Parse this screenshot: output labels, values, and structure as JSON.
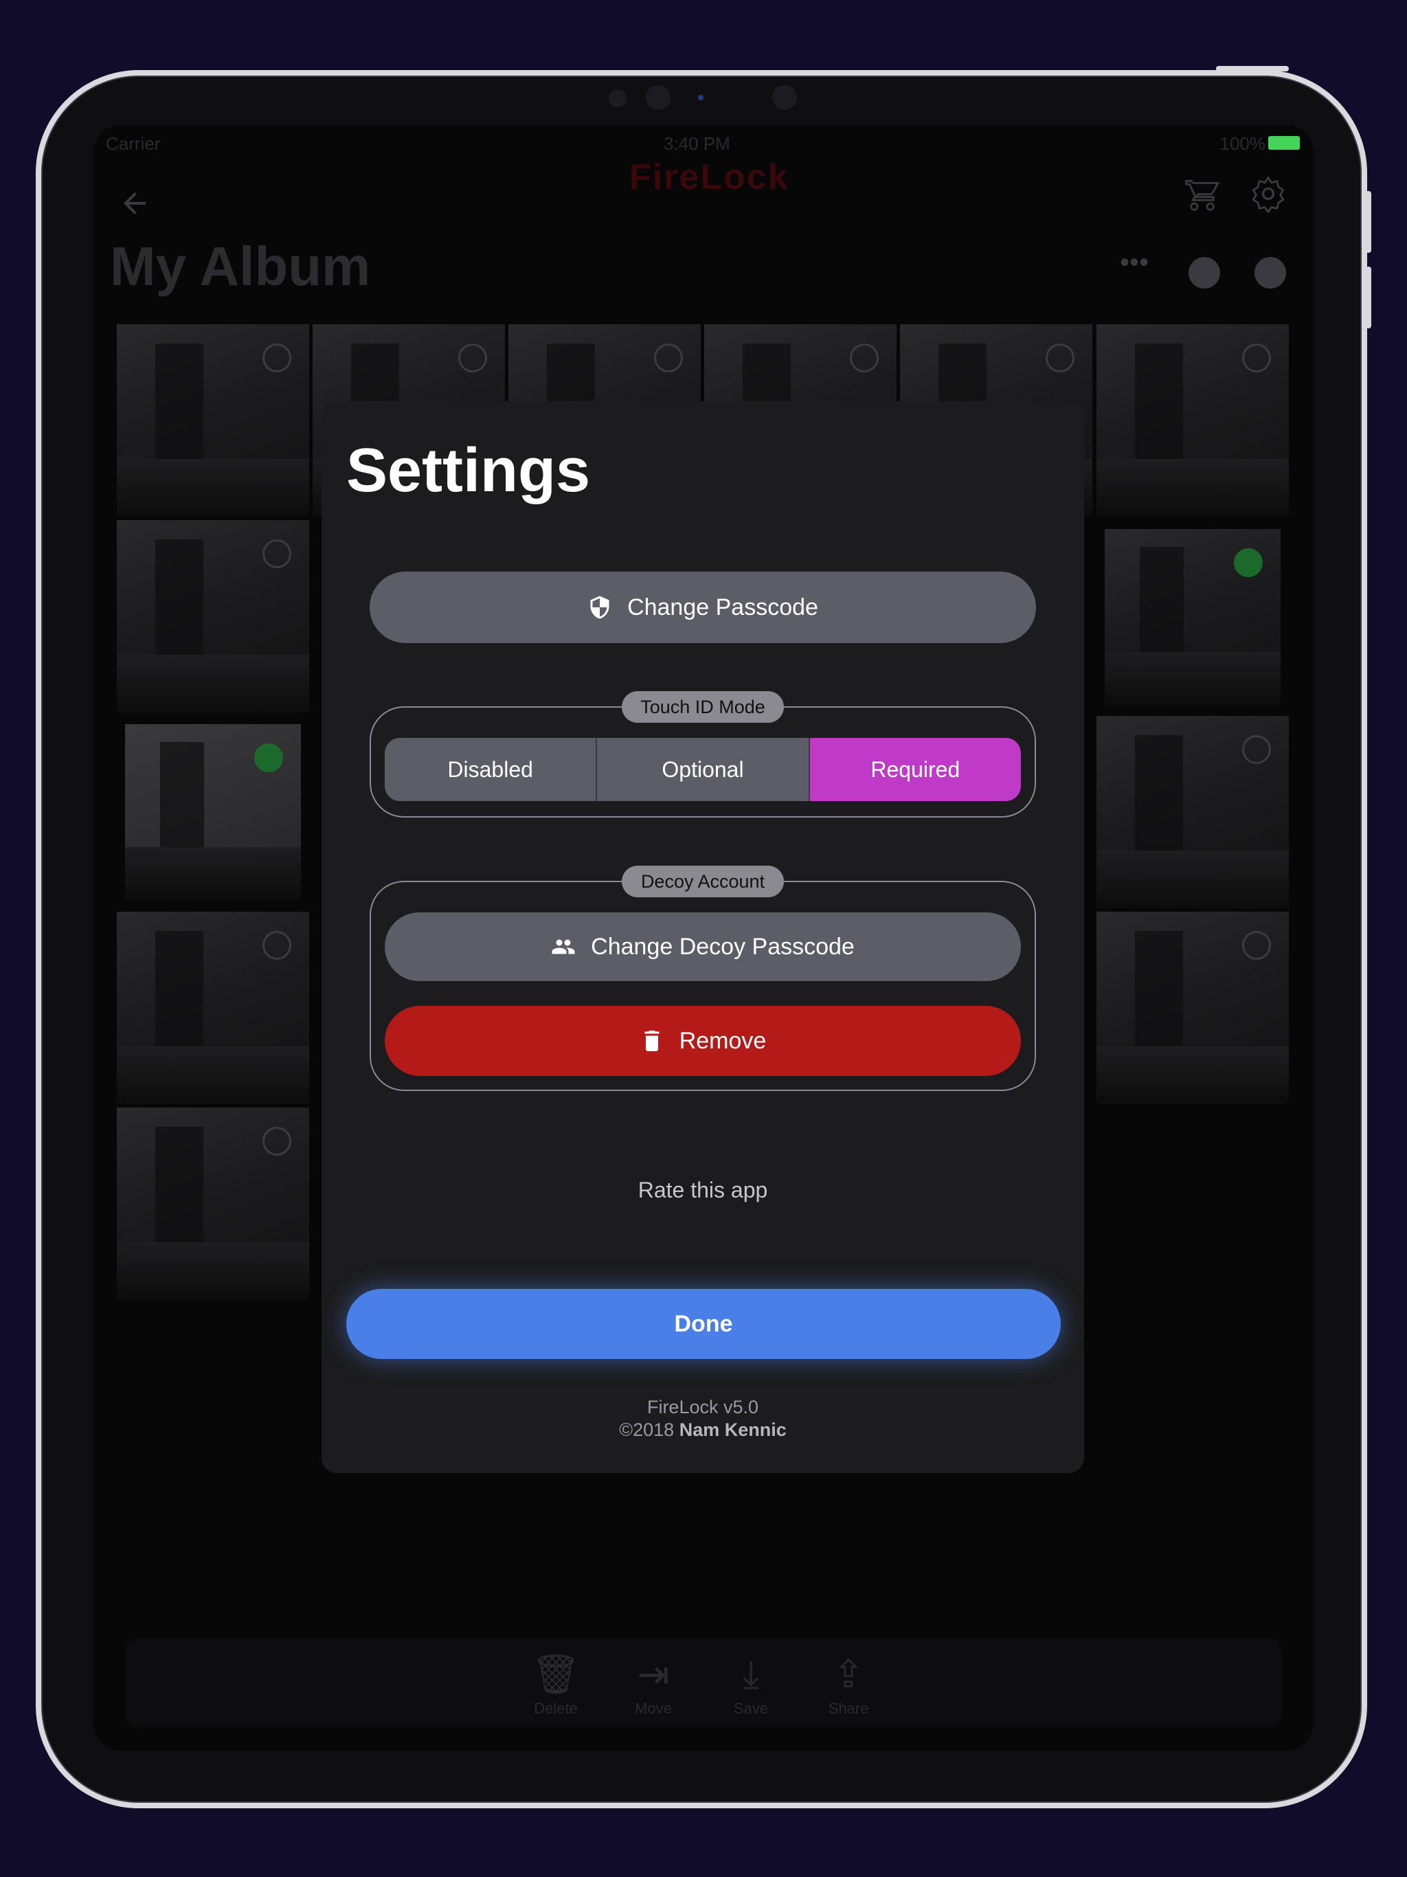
{
  "background_app": {
    "status": {
      "carrier": "Carrier",
      "time": "3:40 PM",
      "battery": "100%"
    },
    "app_logo": "FireLock",
    "album_title": "My Album",
    "selected_color": "#1b6a2c",
    "toolbar": [
      {
        "label": "Delete",
        "icon": "trash-icon"
      },
      {
        "label": "Move",
        "icon": "move-icon"
      },
      {
        "label": "Save",
        "icon": "download-icon"
      },
      {
        "label": "Share",
        "icon": "share-icon"
      }
    ]
  },
  "settings": {
    "title": "Settings",
    "change_passcode": {
      "label": "Change Passcode",
      "icon": "shield-icon"
    },
    "touch_id": {
      "label": "Touch ID Mode",
      "options": [
        "Disabled",
        "Optional",
        "Required"
      ],
      "selected": "Required",
      "accent": "#c03ac8"
    },
    "decoy": {
      "label": "Decoy Account",
      "change_label": "Change Decoy Passcode",
      "change_icon": "people-icon",
      "remove_label": "Remove",
      "remove_icon": "trash-icon",
      "remove_color": "#b41a18"
    },
    "rate": "Rate this app",
    "done": "Done",
    "done_color": "#4a7fe8",
    "version": "FireLock v5.0",
    "copyright_prefix": "©2018",
    "author": "Nam Kennic"
  }
}
